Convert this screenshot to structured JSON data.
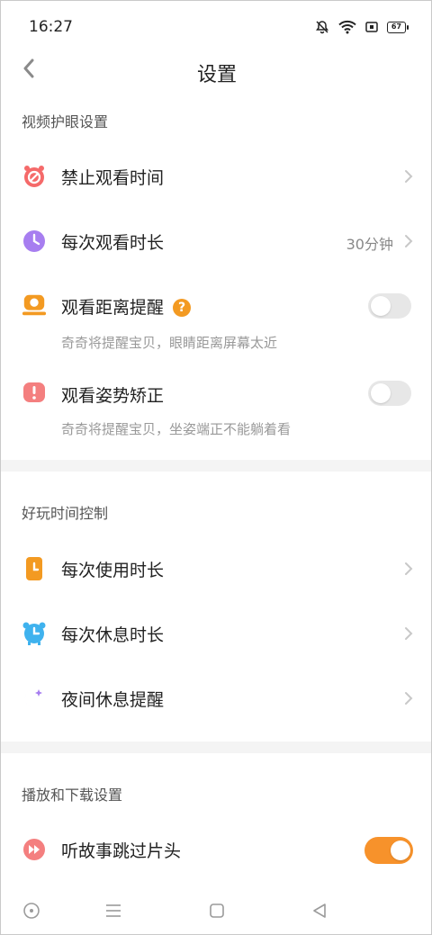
{
  "status_bar": {
    "time": "16:27",
    "battery": "67",
    "icons": [
      "mute-bell-icon",
      "wifi-icon",
      "sim-icon",
      "battery-icon"
    ]
  },
  "header": {
    "title": "设置",
    "back_icon": "chevron-left-icon"
  },
  "sections": [
    {
      "title": "视频护眼设置",
      "items": [
        {
          "label": "禁止观看时间",
          "icon": "alarm-forbidden-icon",
          "control": "chevron"
        },
        {
          "label": "每次观看时长",
          "icon": "clock-icon",
          "value": "30分钟",
          "control": "chevron"
        },
        {
          "label": "观看距离提醒",
          "icon": "screen-distance-icon",
          "help": "?",
          "control": "toggle",
          "on": false,
          "subtitle": "奇奇将提醒宝贝，眼睛距离屏幕太近"
        },
        {
          "label": "观看姿势矫正",
          "icon": "posture-alert-icon",
          "control": "toggle",
          "on": false,
          "subtitle": "奇奇将提醒宝贝，坐姿端正不能躺着看"
        }
      ]
    },
    {
      "title": "好玩时间控制",
      "items": [
        {
          "label": "每次使用时长",
          "icon": "phone-timer-icon",
          "control": "chevron"
        },
        {
          "label": "每次休息时长",
          "icon": "rest-clock-icon",
          "control": "chevron"
        },
        {
          "label": "夜间休息提醒",
          "icon": "moon-star-icon",
          "control": "chevron"
        }
      ]
    },
    {
      "title": "播放和下载设置",
      "items": [
        {
          "label": "听故事跳过片头",
          "icon": "fast-forward-icon",
          "control": "toggle",
          "on": true
        }
      ]
    }
  ],
  "colors": {
    "accent": "#f7922b",
    "help_badge": "#f39a22",
    "toggle_off": "#e7e7e7",
    "section_band": "#f4f4f4"
  },
  "system_nav": [
    "circle-dot-icon",
    "menu-lines-icon",
    "square-home-icon",
    "triangle-back-icon"
  ]
}
